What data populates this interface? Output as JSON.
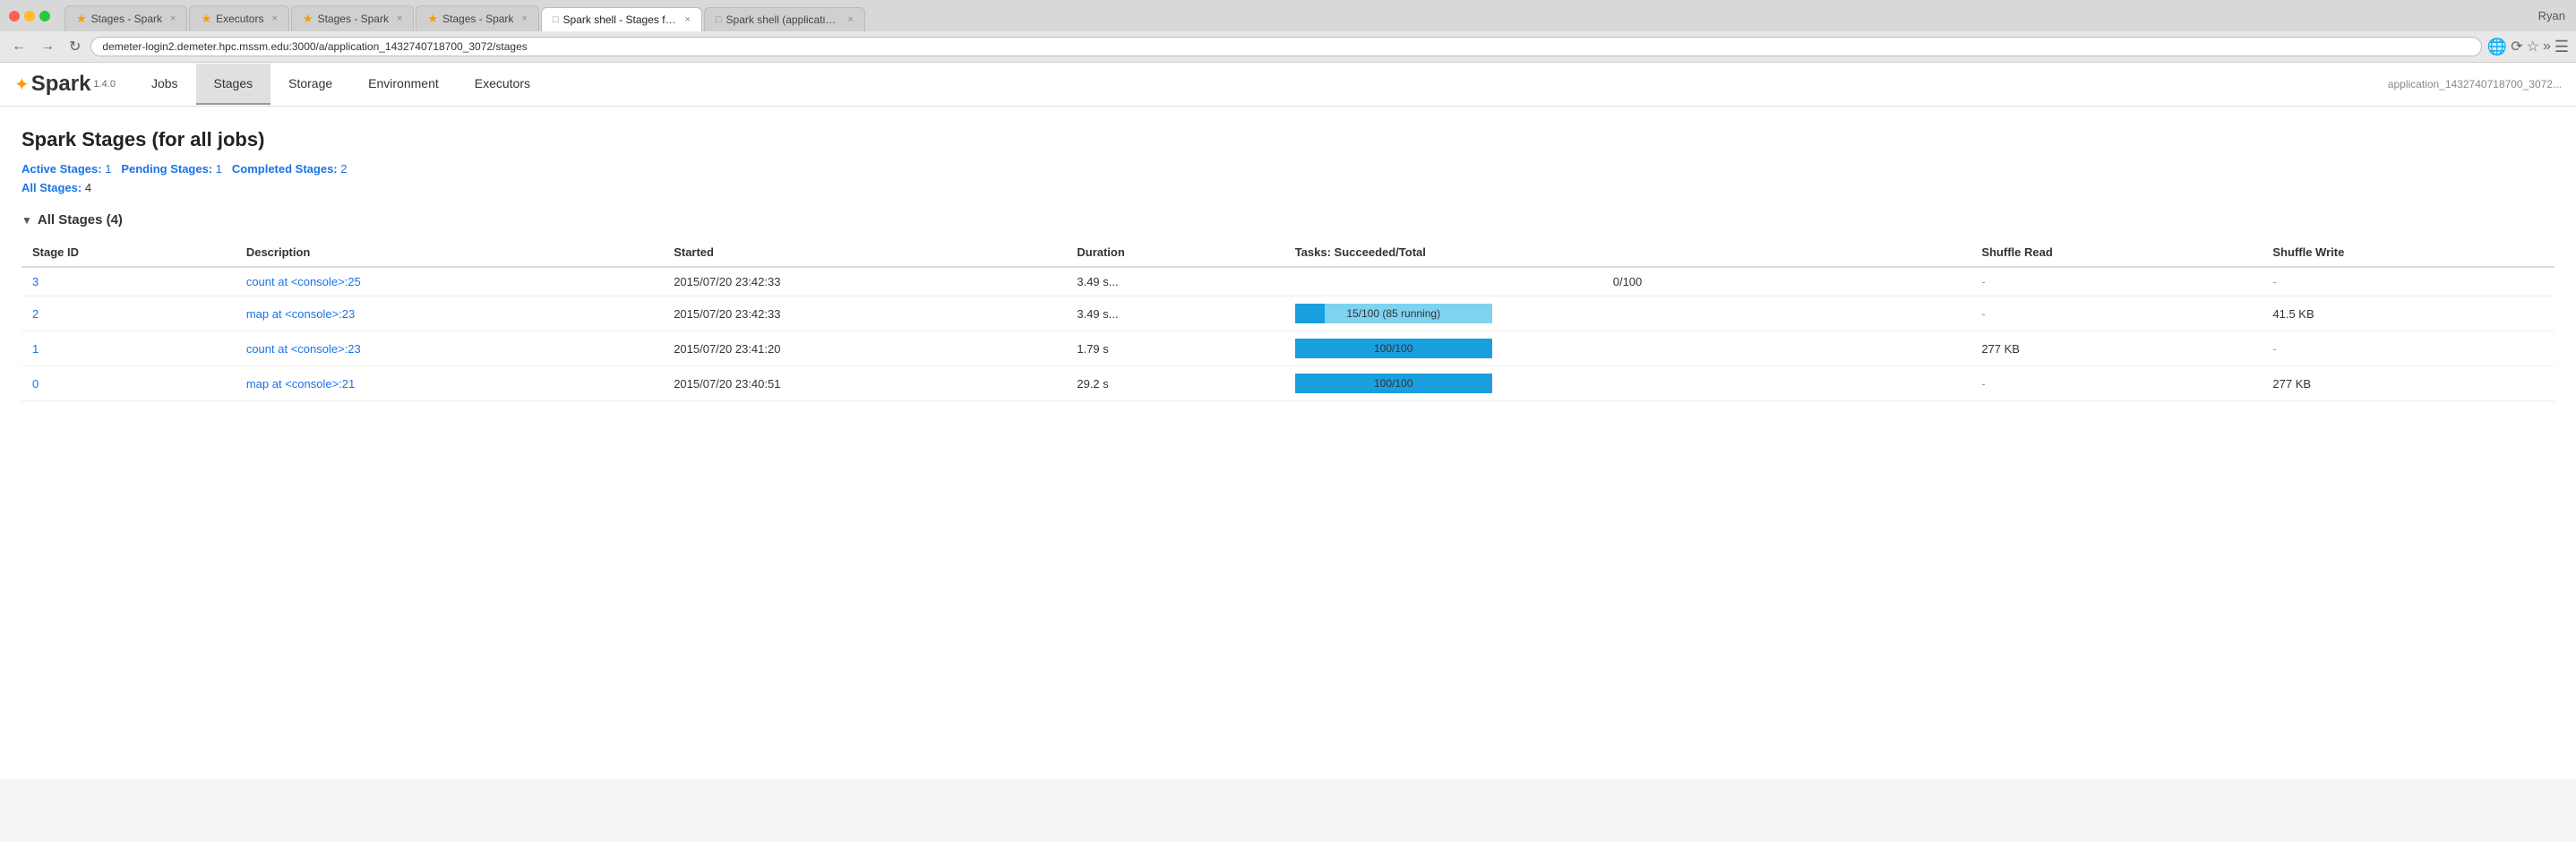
{
  "browser": {
    "traffic_lights": [
      "red",
      "yellow",
      "green"
    ],
    "tabs": [
      {
        "id": "tab1",
        "label": "Stages - Spark",
        "favicon": "star",
        "active": false
      },
      {
        "id": "tab2",
        "label": "Executors",
        "favicon": "star",
        "active": false
      },
      {
        "id": "tab3",
        "label": "Stages - Spark",
        "favicon": "star",
        "active": false
      },
      {
        "id": "tab4",
        "label": "Stages - Spark",
        "favicon": "star",
        "active": false
      },
      {
        "id": "tab5",
        "label": "Spark shell - Stages for All",
        "favicon": "empty",
        "active": true
      },
      {
        "id": "tab6",
        "label": "Spark shell (application_14...",
        "favicon": "empty",
        "active": false
      }
    ],
    "url": "demeter-login2.demeter.hpc.mssm.edu:3000/a/application_1432740718700_3072/stages",
    "user": "Ryan"
  },
  "nav": {
    "logo_text": "Spark",
    "version": "1.4.0",
    "tabs": [
      {
        "id": "jobs",
        "label": "Jobs",
        "active": false
      },
      {
        "id": "stages",
        "label": "Stages",
        "active": true
      },
      {
        "id": "storage",
        "label": "Storage",
        "active": false
      },
      {
        "id": "environment",
        "label": "Environment",
        "active": false
      },
      {
        "id": "executors",
        "label": "Executors",
        "active": false
      }
    ],
    "app_id": "application_1432740718700_3072"
  },
  "page": {
    "title": "Spark Stages (for all jobs)",
    "summary": {
      "active_label": "Active Stages:",
      "active_count": "1",
      "pending_label": "Pending Stages:",
      "pending_count": "1",
      "completed_label": "Completed Stages:",
      "completed_count": "2",
      "all_label": "All Stages:",
      "all_count": "4"
    },
    "all_stages_header": "All Stages (4)",
    "table": {
      "columns": [
        "Stage ID",
        "Description",
        "Started",
        "Duration",
        "Tasks: Succeeded/Total",
        "Shuffle Read",
        "Shuffle Write"
      ],
      "rows": [
        {
          "stage_id": "3",
          "description": "count at <console>:25",
          "started": "2015/07/20 23:42:33",
          "duration": "3.49 s...",
          "tasks_label": "0/100",
          "tasks_succeeded": 0,
          "tasks_running": 0,
          "tasks_total": 100,
          "shuffle_read": "-",
          "shuffle_write": "-"
        },
        {
          "stage_id": "2",
          "description": "map at <console>:23",
          "started": "2015/07/20 23:42:33",
          "duration": "3.49 s...",
          "tasks_label": "15/100 (85 running)",
          "tasks_succeeded": 15,
          "tasks_running": 85,
          "tasks_total": 100,
          "shuffle_read": "-",
          "shuffle_write": "41.5 KB"
        },
        {
          "stage_id": "1",
          "description": "count at <console>:23",
          "started": "2015/07/20 23:41:20",
          "duration": "1.79 s",
          "tasks_label": "100/100",
          "tasks_succeeded": 100,
          "tasks_running": 0,
          "tasks_total": 100,
          "shuffle_read": "277 KB",
          "shuffle_write": "-"
        },
        {
          "stage_id": "0",
          "description": "map at <console>:21",
          "started": "2015/07/20 23:40:51",
          "duration": "29.2 s",
          "tasks_label": "100/100",
          "tasks_succeeded": 100,
          "tasks_running": 0,
          "tasks_total": 100,
          "shuffle_read": "-",
          "shuffle_write": "277 KB"
        }
      ]
    }
  }
}
